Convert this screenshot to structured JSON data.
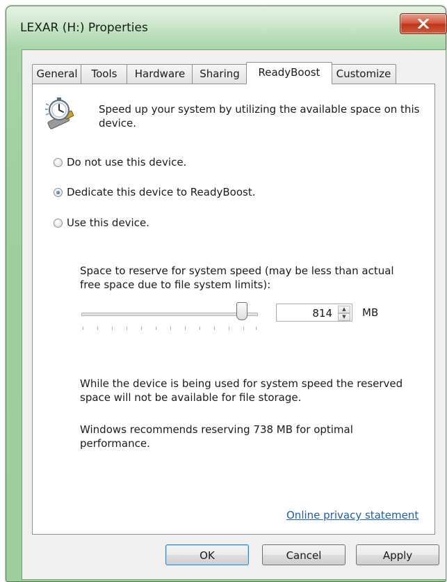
{
  "window": {
    "title": "LEXAR (H:) Properties",
    "accent": "#9ccf9c",
    "close_icon": "close-icon"
  },
  "tabs": [
    {
      "label": "General",
      "active": false
    },
    {
      "label": "Tools",
      "active": false
    },
    {
      "label": "Hardware",
      "active": false
    },
    {
      "label": "Sharing",
      "active": false
    },
    {
      "label": "ReadyBoost",
      "active": true
    },
    {
      "label": "Customize",
      "active": false
    }
  ],
  "readyboost": {
    "icon": "readyboost-icon",
    "intro": "Speed up your system by utilizing the available space on this device.",
    "options": [
      {
        "label": "Do not use this device.",
        "checked": false
      },
      {
        "label": "Dedicate this device to ReadyBoost.",
        "checked": true
      },
      {
        "label": "Use this device.",
        "checked": false
      }
    ],
    "reserve_label": "Space to reserve for system speed (may be less than actual free space due to file system limits):",
    "reserve_value": "814",
    "unit": "MB",
    "slider_level": 0.91,
    "note": "While the device is being used for system speed the reserved space will not be available for file storage.",
    "recommendation": "Windows recommends reserving 738 MB for optimal performance.",
    "privacy_link": "Online privacy statement"
  },
  "buttons": {
    "ok": "OK",
    "cancel": "Cancel",
    "apply": "Apply"
  }
}
